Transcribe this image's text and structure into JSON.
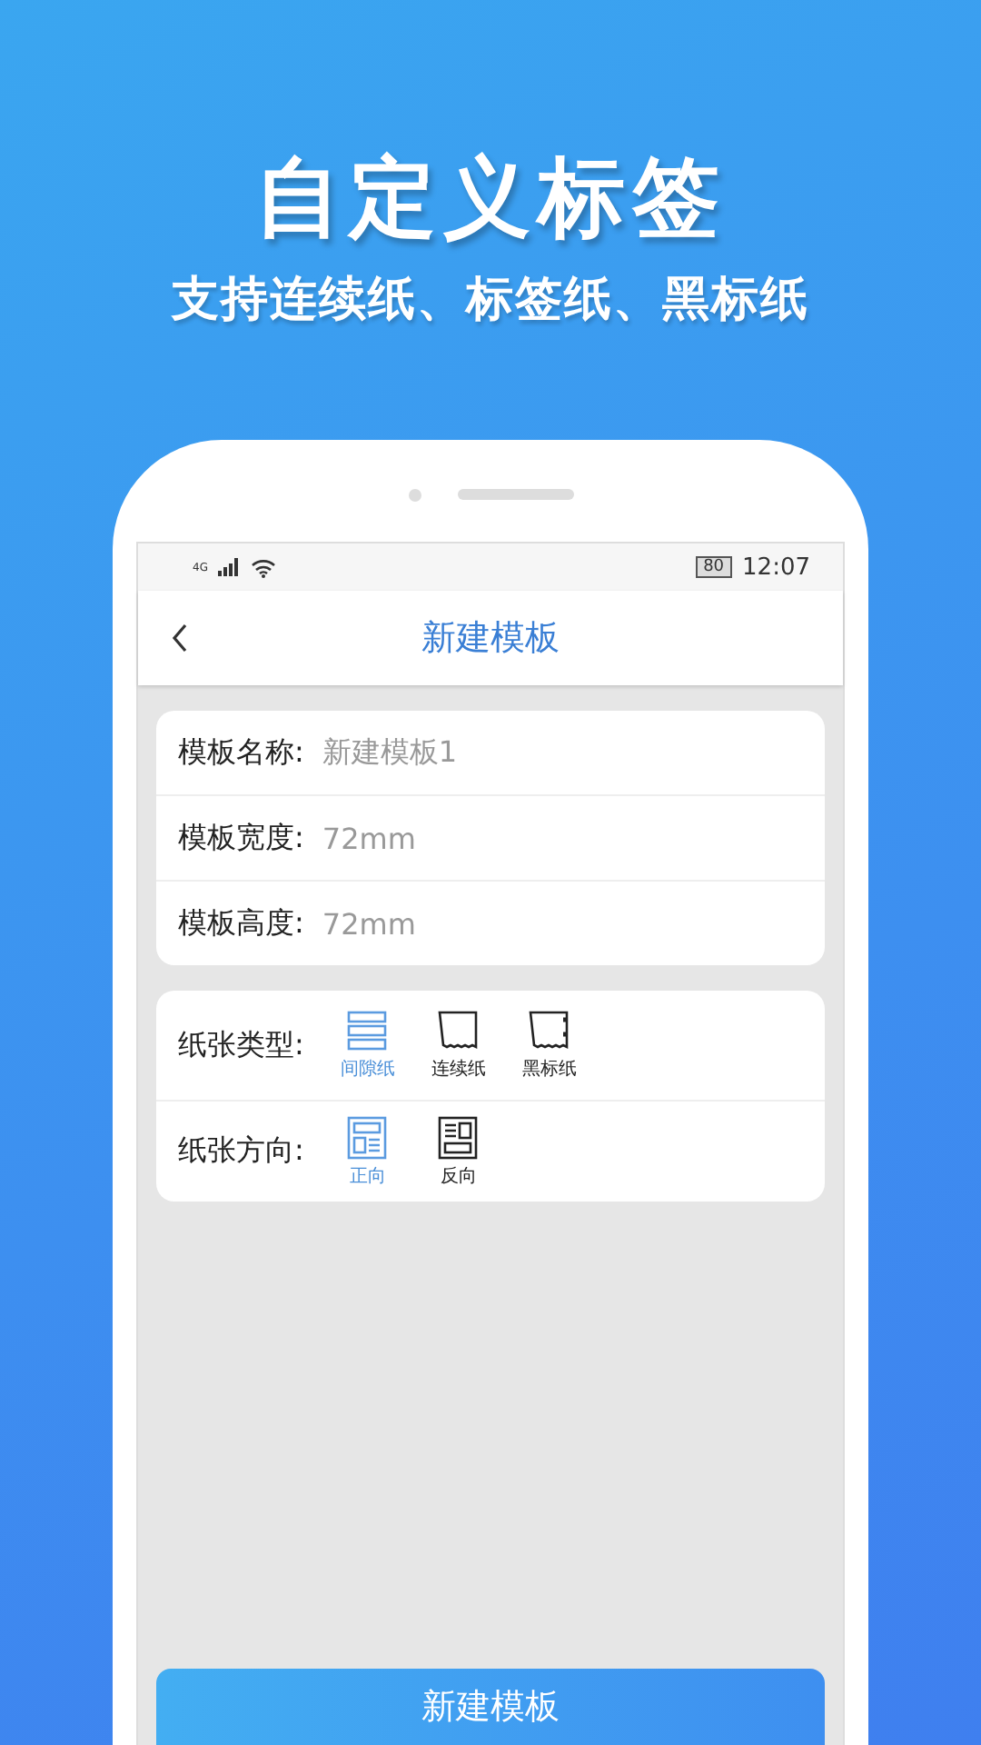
{
  "headline": "自定义标签",
  "subheadline": "支持连续纸、标签纸、黑标纸",
  "status_bar": {
    "network": "4G",
    "battery": "80",
    "time": "12:07"
  },
  "nav": {
    "title": "新建模板"
  },
  "fields": [
    {
      "label": "模板名称:",
      "value": "新建模板1"
    },
    {
      "label": "模板宽度:",
      "value": "72mm"
    },
    {
      "label": "模板高度:",
      "value": "72mm"
    }
  ],
  "paper_type": {
    "label": "纸张类型:",
    "options": [
      {
        "kind": "gap",
        "label": "间隙纸",
        "selected": true
      },
      {
        "kind": "continuous",
        "label": "连续纸",
        "selected": false
      },
      {
        "kind": "blackmark",
        "label": "黑标纸",
        "selected": false
      }
    ]
  },
  "paper_direction": {
    "label": "纸张方向:",
    "options": [
      {
        "kind": "forward",
        "label": "正向",
        "selected": true
      },
      {
        "kind": "reverse",
        "label": "反向",
        "selected": false
      }
    ]
  },
  "create_button": "新建模板"
}
